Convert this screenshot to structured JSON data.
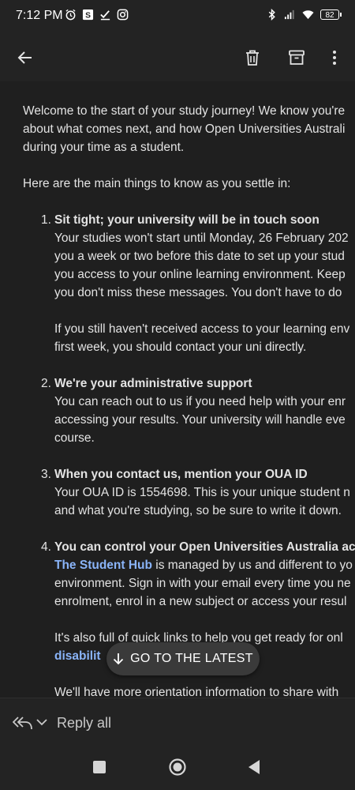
{
  "status_bar": {
    "time": "7:12 PM",
    "left_icons": [
      "alarm-icon",
      "s-app-icon",
      "check-icon",
      "instagram-icon"
    ],
    "right_icons": [
      "bluetooth-icon",
      "signal-icon",
      "wifi-icon"
    ],
    "battery": "82"
  },
  "toolbar": {
    "icons": [
      "back-arrow-icon",
      "delete-icon",
      "archive-icon",
      "more-vert-icon"
    ]
  },
  "email": {
    "intro_lines": [
      "Welcome to the start of your study journey! We know you're",
      "about what comes next, and how Open Universities Australi",
      "during your time as a student."
    ],
    "lead": "Here are the main things to know as you settle in:",
    "items": [
      {
        "num": "1.",
        "title": "Sit tight; your university will be in touch soon",
        "lines": [
          "Your studies won't start until Monday, 26 February 202",
          "you a week or two before this date to set up your stud",
          "you access to your online learning environment. Keep",
          "you don't miss these messages. You don't have to do"
        ],
        "lines2": [
          "If you still haven't received access to your learning env",
          "first week, you should contact your uni directly."
        ]
      },
      {
        "num": "2.",
        "title": "We're your administrative support",
        "lines": [
          "You can reach out to us if you need help with your enr",
          "accessing your results. Your university will handle eve",
          "course."
        ]
      },
      {
        "num": "3.",
        "title": "When you contact us, mention your OUA ID",
        "lines": [
          "Your OUA ID is 1554698. This is your unique student n",
          "and what you're studying, so be sure to write it down."
        ]
      },
      {
        "num": "4.",
        "title": "You can control your Open Universities Australia acco",
        "link_text": "The Student Hub",
        "first_line_rest": " is managed by us and different to yo",
        "lines": [
          "environment. Sign in with your email every time you ne",
          "enrolment, enrol in a new subject or access your resul"
        ],
        "lines2_start": "It's also full of quick links to help you get ready for onl",
        "lines2_link": "disabilit",
        "closing": "We'll have more orientation information to share with"
      }
    ]
  },
  "latest_button": {
    "label": "GO TO THE LATEST",
    "icon": "arrow-down-icon"
  },
  "reply_bar": {
    "label": "Reply all",
    "icon": "reply-all-icon"
  },
  "nav_bar": {
    "icons": [
      "recents-icon",
      "home-icon",
      "back-icon"
    ]
  }
}
